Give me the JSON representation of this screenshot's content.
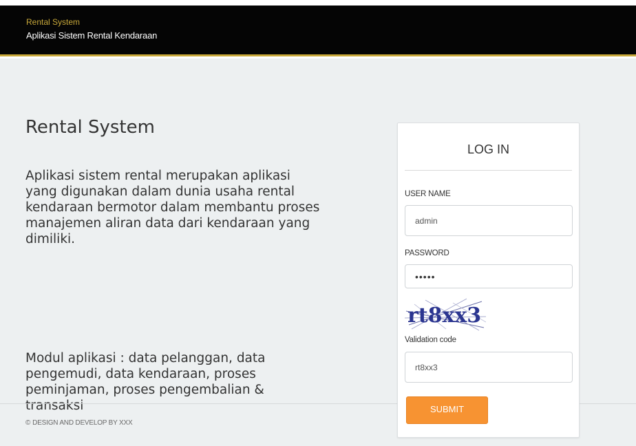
{
  "header": {
    "brand_small": "Rental System",
    "brand_title": "Aplikasi Sistem Rental Kendaraan"
  },
  "intro": {
    "heading": "Rental System",
    "description": "Aplikasi sistem rental merupakan aplikasi yang digunakan dalam dunia usaha rental kendaraan bermotor dalam membantu proses manajemen aliran data dari kendaraan yang dimiliki.",
    "modules": "Modul aplikasi : data pelanggan, data pengemudi, data kendaraan, proses peminjaman, proses pengembalian & transaksi"
  },
  "footer": {
    "copyright_symbol": "©",
    "text": "DESIGN AND DEVELOP BY XXX"
  },
  "login": {
    "title": "LOG IN",
    "username_label": "USER NAME",
    "username_value": "admin",
    "password_label": "PASSWORD",
    "password_value": "•••••",
    "captcha_text": "rt8xx3",
    "validation_label": "Validation code",
    "validation_value": "rt8xx3",
    "submit_label": "SUBMIT"
  },
  "colors": {
    "header_bg": "#050505",
    "accent_gold": "#c9a93a",
    "page_bg": "#edf0f1",
    "submit_bg": "#f79332"
  }
}
